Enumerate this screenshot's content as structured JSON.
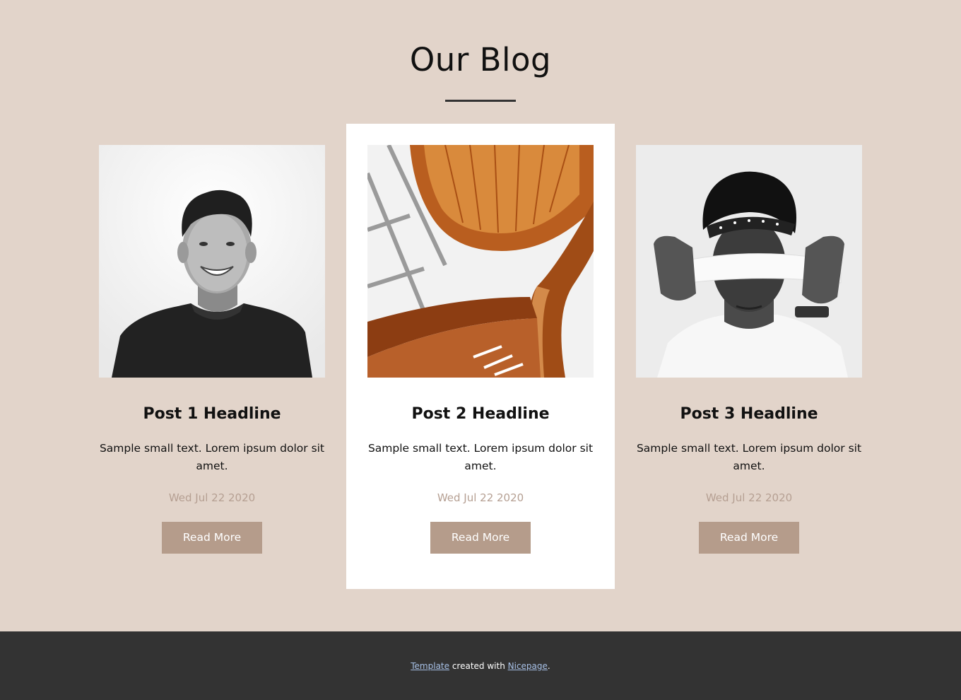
{
  "blog": {
    "title": "Our Blog",
    "posts": [
      {
        "headline": "Post 1 Headline",
        "text": "Sample small text. Lorem ipsum dolor sit amet.",
        "date": "Wed Jul 22 2020",
        "button": "Read More",
        "image": "portrait-smiling-man"
      },
      {
        "headline": "Post 2 Headline",
        "text": "Sample small text. Lorem ipsum dolor sit amet.",
        "date": "Wed Jul 22 2020",
        "button": "Read More",
        "image": "spiral-wooden-staircase"
      },
      {
        "headline": "Post 3 Headline",
        "text": "Sample small text. Lorem ipsum dolor sit amet.",
        "date": "Wed Jul 22 2020",
        "button": "Read More",
        "image": "man-with-blindfold"
      }
    ]
  },
  "footer": {
    "template_link": "Template",
    "middle_text": " created with ",
    "nicepage_link": "Nicepage",
    "end_text": "."
  },
  "colors": {
    "background": "#e2d4ca",
    "card_highlight": "#ffffff",
    "button": "#b59c8b",
    "date": "#b59f92",
    "footer": "#333333",
    "link": "#a7c0e6"
  }
}
